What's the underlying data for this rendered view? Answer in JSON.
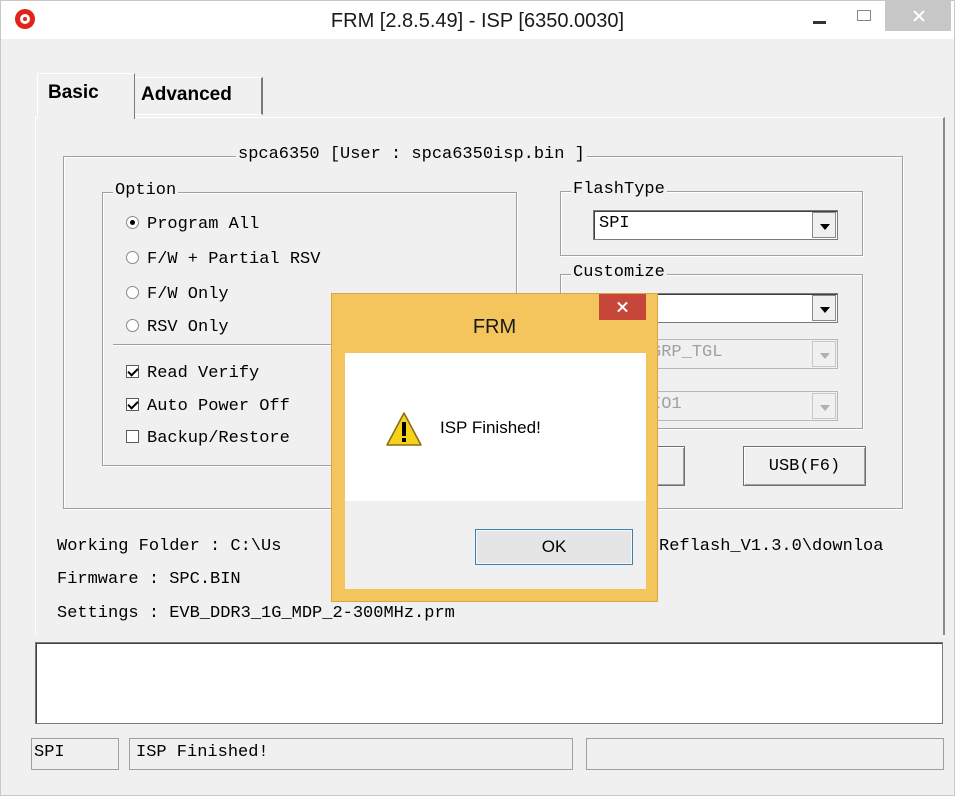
{
  "window": {
    "title": "FRM [2.8.5.49] - ISP [6350.0030]"
  },
  "tabs": [
    {
      "label": "Basic",
      "active": true
    },
    {
      "label": "Advanced",
      "active": false
    }
  ],
  "chip_group": {
    "title": "spca6350 [User : spca6350isp.bin ]"
  },
  "option_group": {
    "title": "Option",
    "radios": [
      {
        "label": "Program All",
        "selected": true
      },
      {
        "label": "F/W + Partial RSV",
        "selected": false
      },
      {
        "label": "F/W Only",
        "selected": false
      },
      {
        "label": "RSV Only",
        "selected": false
      }
    ],
    "checkboxes": [
      {
        "label": "Read Verify",
        "checked": true
      },
      {
        "label": "Auto Power Off",
        "checked": true
      },
      {
        "label": "Backup/Restore",
        "checked": false
      }
    ]
  },
  "flashtype_group": {
    "title": "FlashType",
    "selected": "SPI"
  },
  "customize_group": {
    "title": "Customize",
    "combo1": "",
    "combo2": "GRP_TGL",
    "combo3": "IO1"
  },
  "buttons": {
    "usb_label": "USB(F6)"
  },
  "info": {
    "working_folder": "Working Folder :  C:\\Us",
    "working_folder_tail": "Reflash_V1.3.0\\downloa",
    "firmware": "Firmware :  SPC.BIN",
    "settings": "Settings :  EVB_DDR3_1G_MDP_2-300MHz.prm"
  },
  "status_bar": {
    "flash_type": "SPI",
    "message": "ISP Finished!",
    "extra": ""
  },
  "dialog": {
    "title": "FRM",
    "message": "ISP Finished!",
    "ok_label": "OK",
    "icon": "warning-icon"
  },
  "colors": {
    "dialog_frame": "#f4c55c",
    "dialog_close": "#c7463a",
    "window_bg": "#f0f0f0"
  }
}
